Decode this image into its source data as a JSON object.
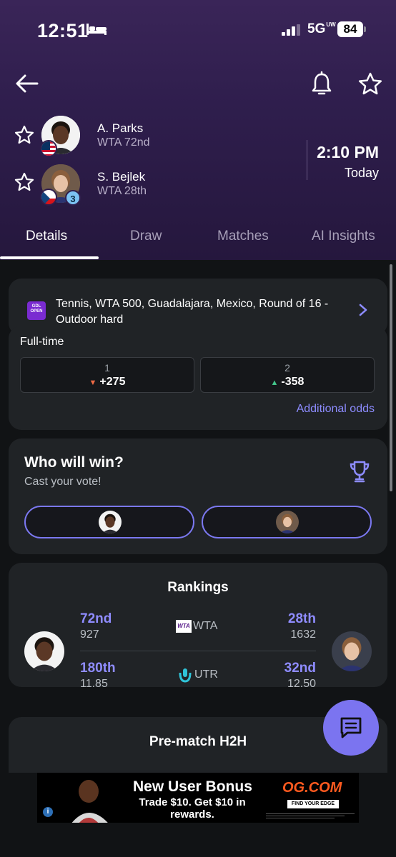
{
  "status_bar": {
    "time": "12:51",
    "network": "5G",
    "network_badge": "UW",
    "battery": "84"
  },
  "match": {
    "players": [
      {
        "name": "A. Parks",
        "ranking": "WTA 72nd",
        "flag": "USA"
      },
      {
        "name": "S. Bejlek",
        "ranking": "WTA 28th",
        "flag": "Czechia",
        "seed": "3"
      }
    ],
    "start_time": "2:10 PM",
    "start_day": "Today"
  },
  "tabs": [
    {
      "label": "Details",
      "active": true
    },
    {
      "label": "Draw"
    },
    {
      "label": "Matches"
    },
    {
      "label": "AI Insights"
    }
  ],
  "tournament": {
    "logo_text": "GDL OPEN",
    "text": "Tennis, WTA 500, Guadalajara, Mexico, Round of 16 - Outdoor hard"
  },
  "odds": {
    "label": "Full-time",
    "items": [
      {
        "num": "1",
        "value": "+275",
        "trend": "down"
      },
      {
        "num": "2",
        "value": "-358",
        "trend": "up"
      }
    ],
    "additional_label": "Additional odds"
  },
  "vote": {
    "title": "Who will win?",
    "subtitle": "Cast your vote!"
  },
  "rankings": {
    "title": "Rankings",
    "wta": {
      "source": "WTA",
      "logo_text": "WTA",
      "p1_rank": "72nd",
      "p1_points": "927",
      "p2_rank": "28th",
      "p2_points": "1632"
    },
    "utr": {
      "source": "UTR",
      "p1_rank": "180th",
      "p1_points": "11.85",
      "p2_rank": "32nd",
      "p2_points": "12.50"
    }
  },
  "h2h": {
    "title": "Pre-match H2H"
  },
  "ad": {
    "headline": "New User Bonus",
    "subline": "Trade $10. Get $10 in rewards.",
    "brand": "OG.COM",
    "cta": "FIND YOUR EDGE"
  },
  "colors": {
    "accent": "#8f8cff",
    "header_bg": "#2f1e4d",
    "card_bg": "#202326",
    "odds_down": "#ef6b45",
    "odds_up": "#43c48a",
    "fab": "#7b74f0"
  },
  "icons": [
    "back-arrow-icon",
    "bell-icon",
    "star-icon",
    "chevron-right-icon",
    "trophy-icon",
    "chat-icon",
    "info-icon"
  ]
}
